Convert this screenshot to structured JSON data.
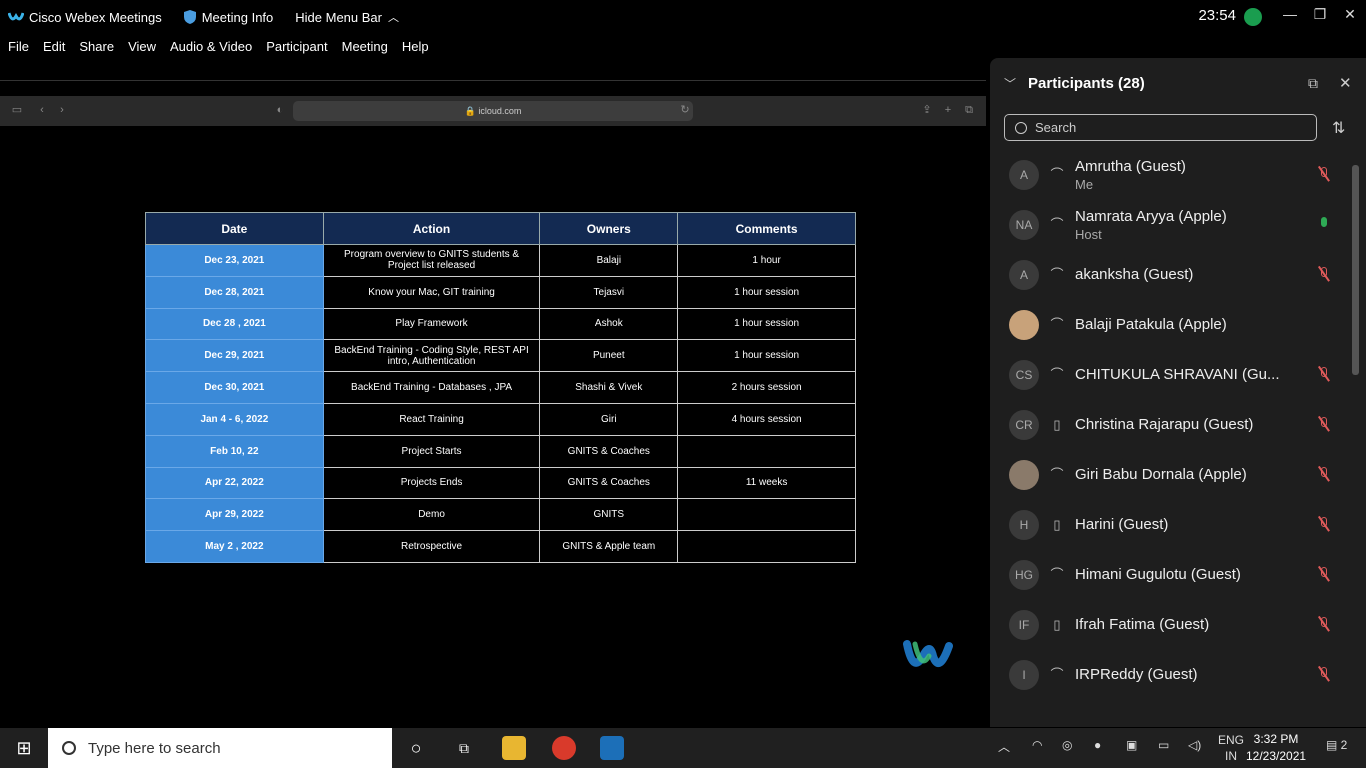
{
  "title_bar": {
    "app_name": "Cisco Webex Meetings",
    "meeting_info": "Meeting Info",
    "hide_menu": "Hide Menu Bar",
    "time": "23:54"
  },
  "menu": [
    "File",
    "Edit",
    "Share",
    "View",
    "Audio & Video",
    "Participant",
    "Meeting",
    "Help"
  ],
  "browser": {
    "url": "icloud.com"
  },
  "schedule": {
    "headers": [
      "Date",
      "Action",
      "Owners",
      "Comments"
    ],
    "rows": [
      [
        "Dec 23, 2021",
        "Program overview to GNITS students & Project list released",
        "Balaji",
        "1 hour"
      ],
      [
        "Dec 28, 2021",
        "Know your Mac, GIT training",
        "Tejasvi",
        "1 hour session"
      ],
      [
        "Dec 28 , 2021",
        "Play Framework",
        "Ashok",
        "1 hour session"
      ],
      [
        "Dec 29, 2021",
        "BackEnd Training - Coding Style, REST API intro, Authentication",
        "Puneet",
        "1 hour session"
      ],
      [
        "Dec 30, 2021",
        "BackEnd Training - Databases , JPA",
        "Shashi & Vivek",
        "2 hours session"
      ],
      [
        "Jan 4 - 6, 2022",
        "React Training",
        "Giri",
        "4 hours session"
      ],
      [
        "Feb 10, 22",
        "Project Starts",
        "GNITS & Coaches",
        ""
      ],
      [
        "Apr 22, 2022",
        "Projects Ends",
        "GNITS & Coaches",
        "11 weeks"
      ],
      [
        "Apr 29, 2022",
        "Demo",
        "GNITS",
        ""
      ],
      [
        "May 2 , 2022",
        "Retrospective",
        "GNITS & Apple team",
        ""
      ]
    ]
  },
  "participants": {
    "title": "Participants (28)",
    "search_placeholder": "Search",
    "list": [
      {
        "initials": "A",
        "name": "Amrutha (Guest)",
        "sub": "Me",
        "device": "headset-icon",
        "muted": true
      },
      {
        "initials": "NA",
        "name": "Namrata Aryya (Apple)",
        "sub": "Host",
        "device": "headset-icon",
        "muted": false
      },
      {
        "initials": "A",
        "name": "akanksha (Guest)",
        "sub": "",
        "device": "headset-icon",
        "muted": true
      },
      {
        "initials": "",
        "name": "Balaji Patakula (Apple)",
        "sub": "",
        "device": "headset-icon",
        "muted": false
      },
      {
        "initials": "CS",
        "name": "CHITUKULA SHRAVANI (Gu...",
        "sub": "",
        "device": "headset-icon",
        "muted": true
      },
      {
        "initials": "CR",
        "name": "Christina Rajarapu (Guest)",
        "sub": "",
        "device": "phone-icon",
        "muted": true
      },
      {
        "initials": "",
        "name": "Giri Babu Dornala (Apple)",
        "sub": "",
        "device": "headset-icon",
        "muted": true
      },
      {
        "initials": "H",
        "name": "Harini (Guest)",
        "sub": "",
        "device": "phone-icon",
        "muted": true
      },
      {
        "initials": "HG",
        "name": "Himani Gugulotu (Guest)",
        "sub": "",
        "device": "headset-icon",
        "muted": true
      },
      {
        "initials": "IF",
        "name": "Ifrah Fatima (Guest)",
        "sub": "",
        "device": "phone-icon",
        "muted": true
      },
      {
        "initials": "I",
        "name": "IRPReddy (Guest)",
        "sub": "",
        "device": "headset-icon",
        "muted": true
      }
    ]
  },
  "taskbar": {
    "search_placeholder": "Type here to search",
    "lang_1": "ENG",
    "lang_2": "IN",
    "time": "3:32 PM",
    "date": "12/23/2021",
    "notifications": "2"
  }
}
